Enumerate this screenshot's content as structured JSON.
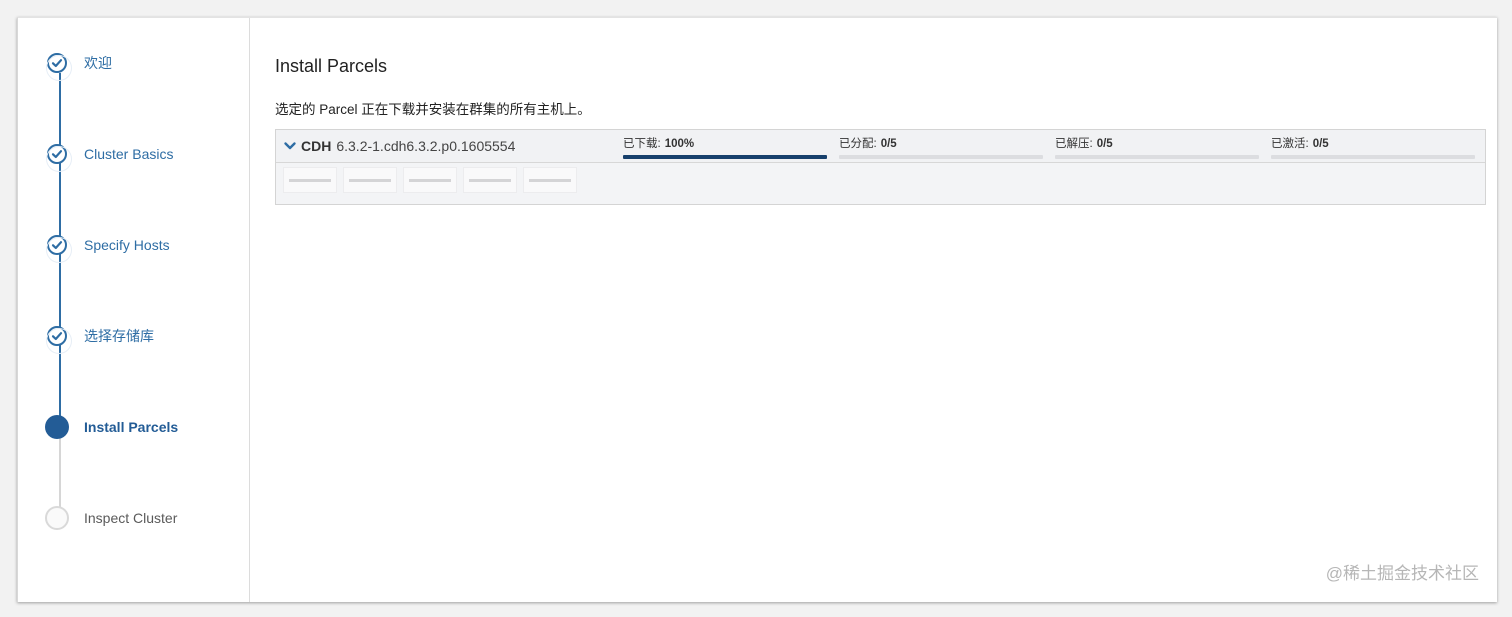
{
  "sidebar": {
    "steps": [
      {
        "label": "欢迎",
        "state": "done"
      },
      {
        "label": "Cluster Basics",
        "state": "done"
      },
      {
        "label": "Specify Hosts",
        "state": "done"
      },
      {
        "label": "选择存储库",
        "state": "done"
      },
      {
        "label": "Install Parcels",
        "state": "current"
      },
      {
        "label": "Inspect Cluster",
        "state": "todo"
      }
    ]
  },
  "main": {
    "title": "Install Parcels",
    "description": "选定的 Parcel 正在下载并安装在群集的所有主机上。",
    "parcel": {
      "name": "CDH",
      "version": "6.3.2-1.cdh6.3.2.p0.1605554",
      "stages": [
        {
          "label": "已下载:",
          "value": "100%",
          "progress": 1.0
        },
        {
          "label": "已分配:",
          "value": "0/5",
          "progress": 0.0
        },
        {
          "label": "已解压:",
          "value": "0/5",
          "progress": 0.0
        },
        {
          "label": "已激活:",
          "value": "0/5",
          "progress": 0.0
        }
      ]
    }
  },
  "watermark": "@稀土掘金技术社区",
  "colors": {
    "accent": "#2e6da4",
    "current_step": "#235c96",
    "progress_fill": "#17406c",
    "progress_track": "#dcdde0"
  },
  "icons": {
    "completed_step": "check-circle-icon",
    "current_step": "filled-circle-icon",
    "pending_step": "empty-circle-icon",
    "expand": "chevron-down-icon"
  }
}
